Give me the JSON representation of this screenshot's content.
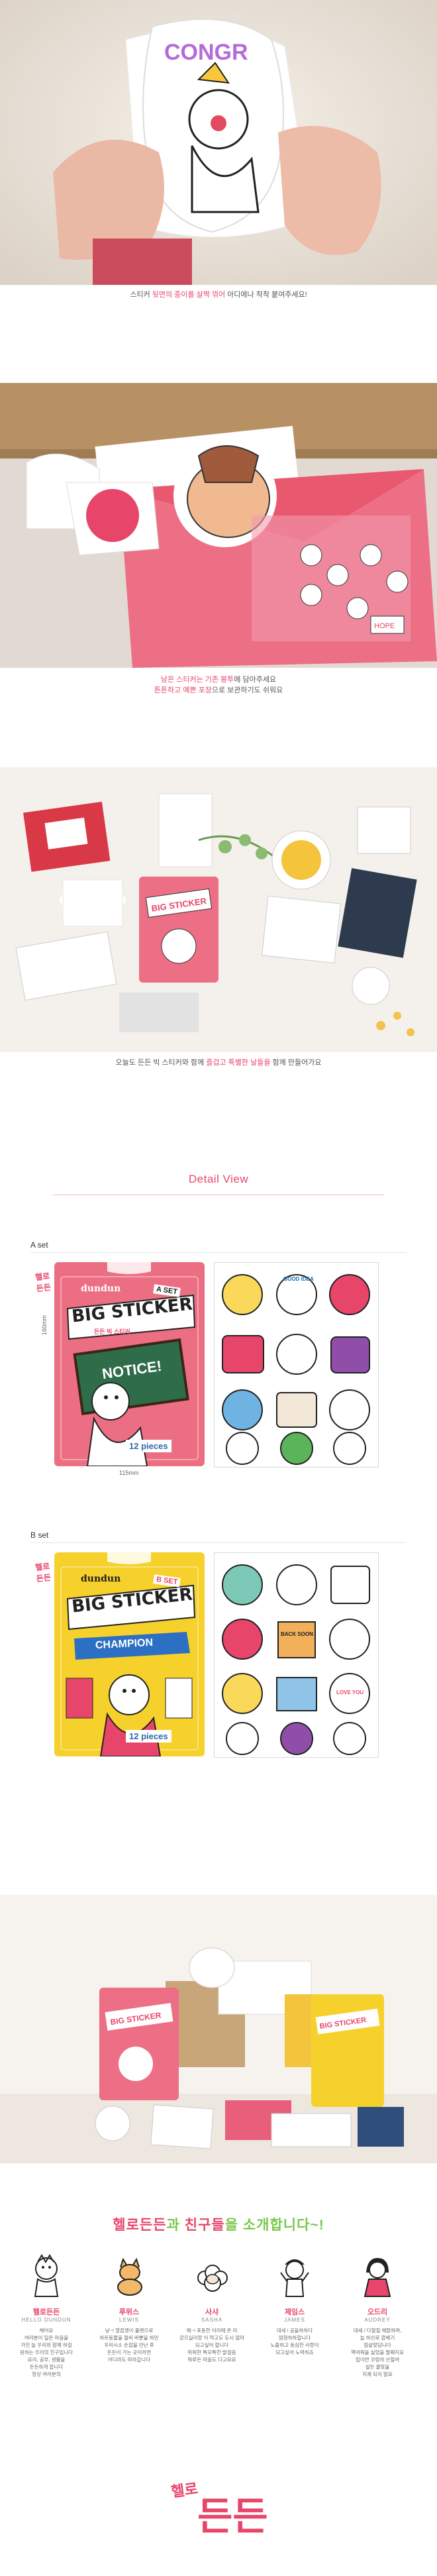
{
  "photo1": {
    "caption_a": "스티커 ",
    "caption_hl": "뒷면의 종이를 살짝 꺾어",
    "caption_b": " 아디에나 착착 붙여주세요!"
  },
  "photo2": {
    "line1_hl": "남은 스티커는 기존 봉투",
    "line1_b": "에 담아주세요",
    "line2_hl": "튼튼하고 예쁜 포장",
    "line2_b": "으로 보관하기도 쉬워요"
  },
  "photo3": {
    "caption_a": "오늘도 든든 빅 스티커와 함께 ",
    "caption_hl": "즐겁고 특별한 날들을",
    "caption_b": " 함께 만들어가요"
  },
  "detail": {
    "title": "Detail View"
  },
  "set_a": {
    "label": "A set",
    "pkg_brand": "dundun",
    "pkg_title": "BIG STICKER",
    "pkg_sub": "든든 빅 스티커",
    "pkg_tag": "A SET",
    "pkg_notice": "NOTICE!",
    "pkg_pieces": "12 pieces",
    "width_dim": "115mm",
    "height_dim": "160mm"
  },
  "set_b": {
    "label": "B set",
    "pkg_brand": "dundun",
    "pkg_title": "BIG STICKER",
    "pkg_tag": "B SET",
    "pkg_banner": "CHAMPION",
    "pkg_pieces": "12 pieces"
  },
  "sticker_texts": {
    "good_idea": "GOOD IDEA",
    "congrats": "CONGRATS",
    "hope": "HOPE",
    "love": "LOVE YOU",
    "back": "BACK SOON"
  },
  "intro": {
    "title_a": "헬로든든",
    "title_b": "과 ",
    "title_c": "친구들",
    "title_d": "을 소개합니다~!"
  },
  "characters": [
    {
      "name": "헬로든든",
      "en": "HELLO DUNDUN",
      "desc": "헤어요\n여러분이 일은 마음을\n가진 늘 우리와 함께 하길\n원하는 우리의 친구입니다\n요리, 공부, 생활을\n든든하게 합니다\n항상 여러분의"
    },
    {
      "name": "루위스",
      "en": "LEWIS",
      "desc": "냥~! 깔끔쟁이 플랫으로\n하트동물을 절비 바뿐을 하만\n우리시소 손잡을 만난 후\n든든이 가는 곳이라면\n어디라도 따라갑니다"
    },
    {
      "name": "사샤",
      "en": "SASHA",
      "desc": "메~! 포동한 이리에 온 미\n걷으실리랑 이 먹고도 도시 엄마\n되고싶어 합니다\n위워한 특모특한 발걸음\n뭐루든 마음도 다고요요"
    },
    {
      "name": "제임스",
      "en": "JAMES",
      "desc": "대세 ! 공을하하다\n엄청하하합니다\n노출하고 동심한 사랑이\n되고싶어 노력하죠"
    },
    {
      "name": "오드리",
      "en": "AUDREY",
      "desc": "대세 / 다혈질 해맑하며,\n늘 하선로 깜배기\n엄살맞담니다\n핵여워을 싫었을 뭘웨지요\n집이면 코렁히 산절여\n설든 쿨맞을\n지제 되지 말요"
    }
  ],
  "logo": {
    "text": "헬로든든"
  }
}
